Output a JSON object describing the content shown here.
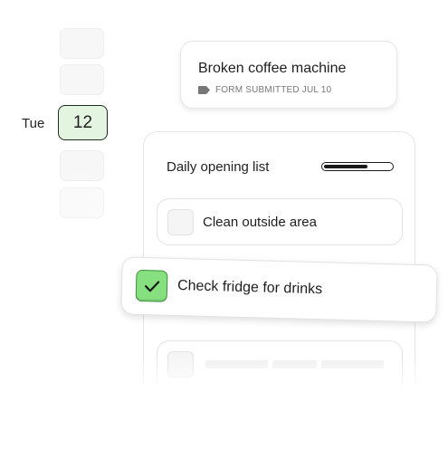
{
  "calendar": {
    "day_label": "Tue",
    "date": "12"
  },
  "issue": {
    "title": "Broken coffee machine",
    "status": "FORM SUBMITTED JUL 10",
    "icon": "tag-icon"
  },
  "checklist": {
    "title": "Daily opening list",
    "progress_fraction": 0.65,
    "tasks": [
      {
        "label": "Clean outside area",
        "checked": false
      },
      {
        "label": "Check fridge for drinks",
        "checked": true
      }
    ]
  },
  "colors": {
    "accent_green": "#86e07f",
    "selected_date_bg": "#e3f5e1"
  }
}
